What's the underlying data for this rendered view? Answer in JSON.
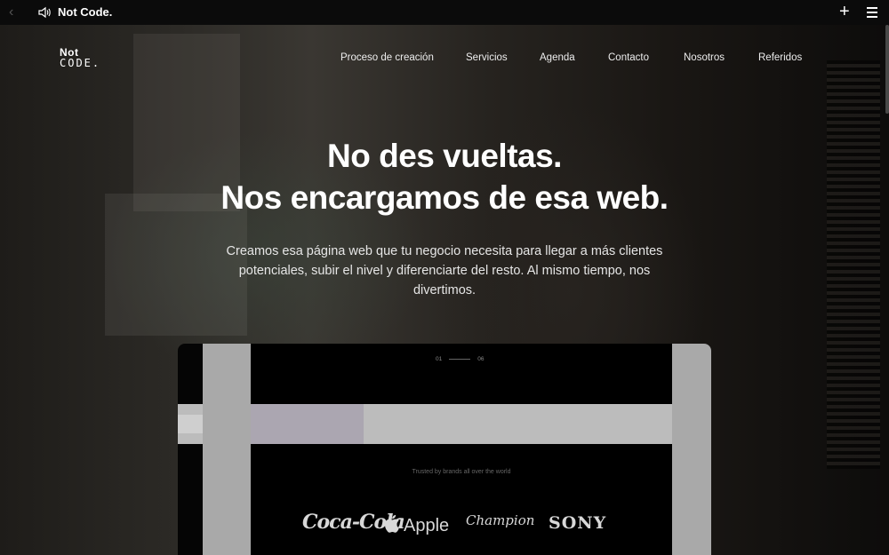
{
  "topbar": {
    "title": "Not Code.",
    "back_icon": "chevron-left-icon",
    "speaker_icon": "speaker-icon",
    "plus_icon": "plus-icon",
    "menu_icon": "hamburger-menu-icon"
  },
  "logo": {
    "line1": "Not",
    "line2": "CODE."
  },
  "nav": {
    "items": [
      {
        "label": "Proceso de creación"
      },
      {
        "label": "Servicios"
      },
      {
        "label": "Agenda"
      },
      {
        "label": "Contacto"
      },
      {
        "label": "Nosotros"
      },
      {
        "label": "Referidos"
      }
    ]
  },
  "hero": {
    "headline_line1": "No des vueltas.",
    "headline_line2": "Nos encargamos de esa web.",
    "subtitle": "Creamos esa página web que tu negocio necesita para llegar a más clientes potenciales, subir el nivel y diferenciarte del resto. Al mismo tiempo, nos divertimos."
  },
  "mockup": {
    "slide_current": "01",
    "slide_total": "06",
    "trusted_text": "Trusted by brands all over the world",
    "brands": [
      "Coca-Cola",
      "Apple",
      "Champion",
      "SONY"
    ]
  },
  "colors": {
    "background": "#000000",
    "text": "#ffffff",
    "panel_gray": "#a9a9a9",
    "lilac": "#aba6b1"
  }
}
